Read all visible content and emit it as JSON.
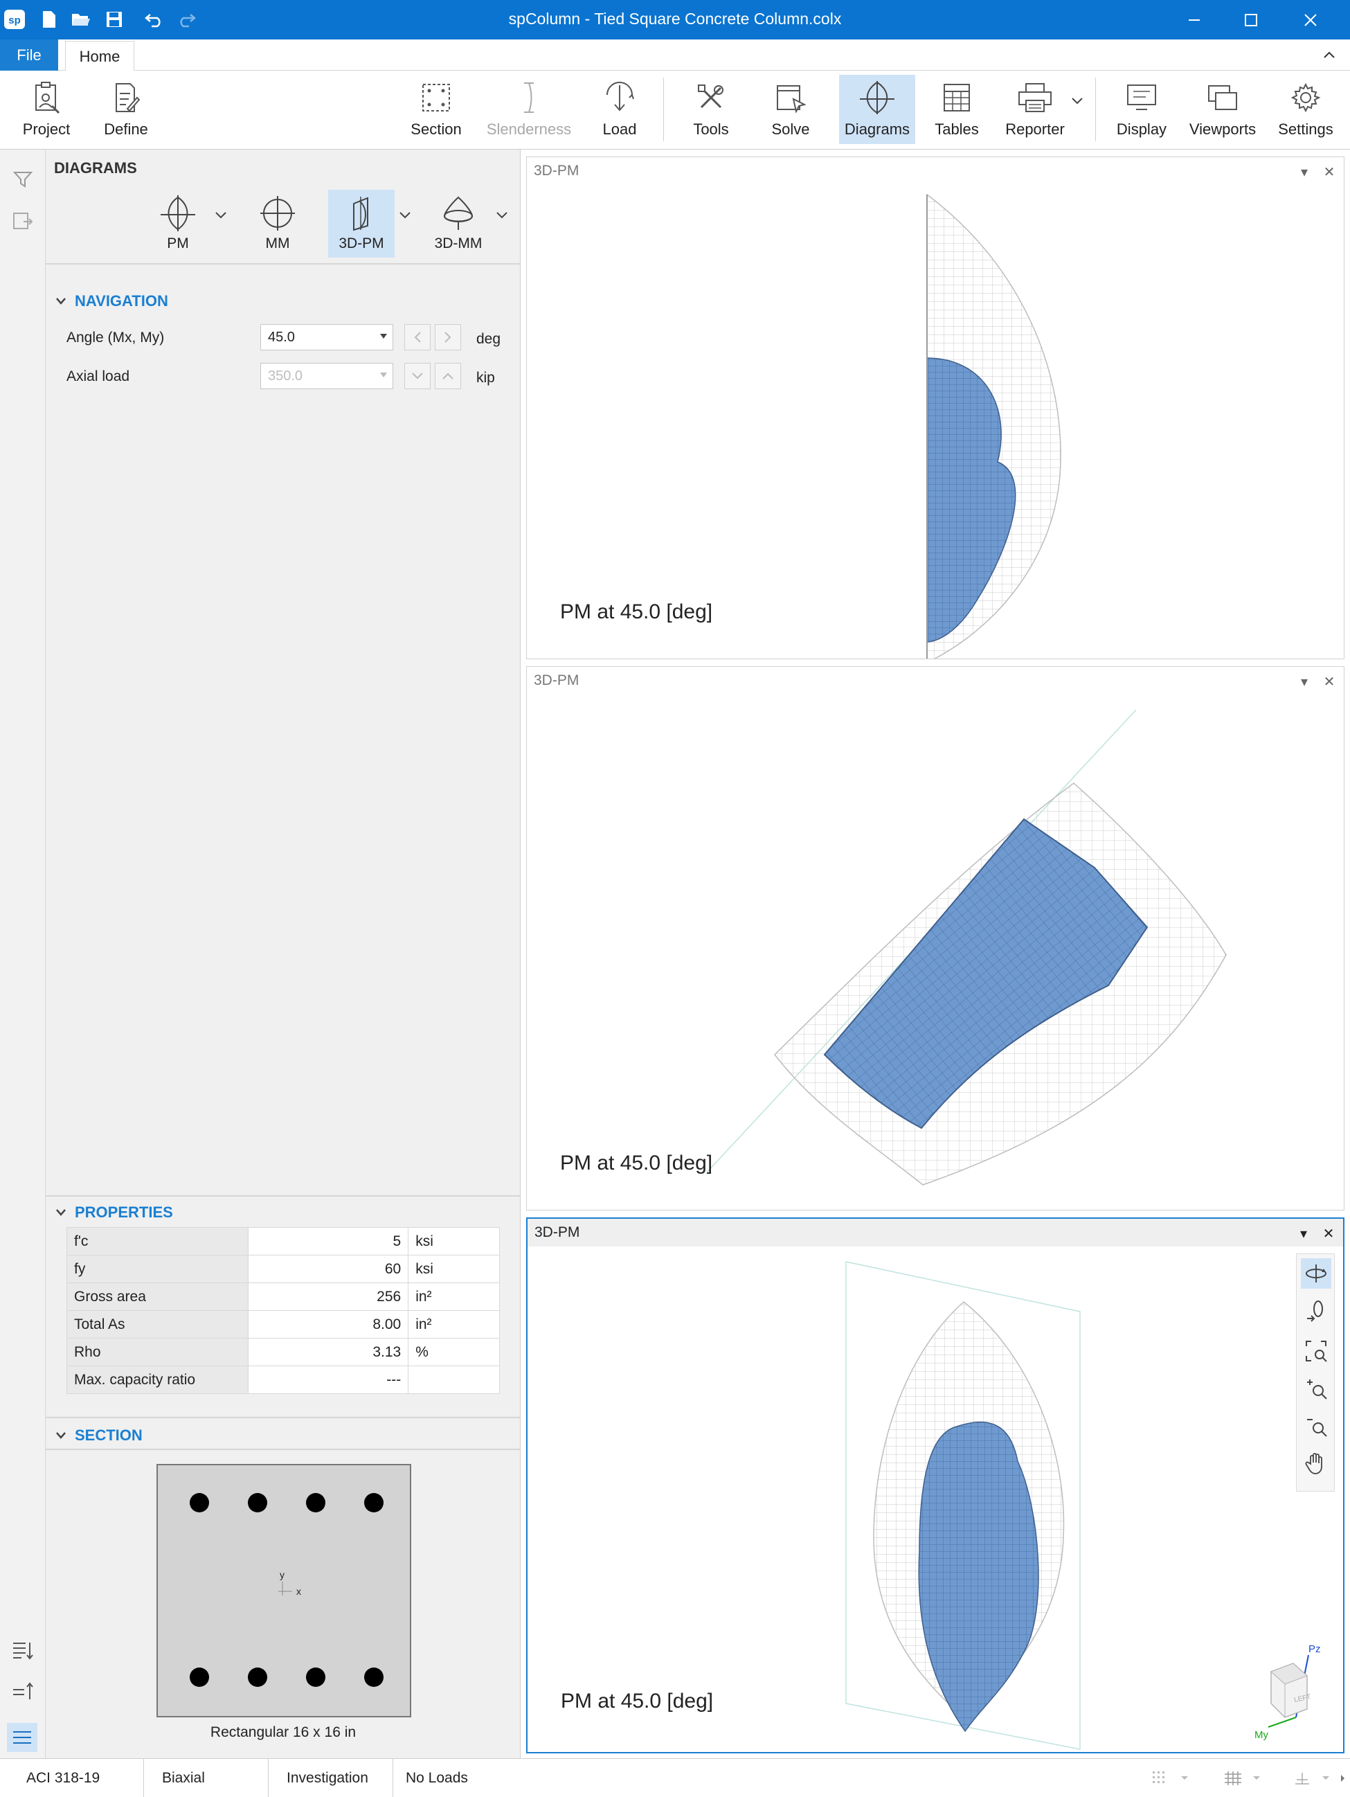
{
  "window": {
    "title": "spColumn - Tied Square Concrete Column.colx"
  },
  "quick_access": [
    "sp-logo-icon",
    "new-icon",
    "open-icon",
    "save-icon",
    "undo-icon",
    "redo-icon"
  ],
  "tabs": {
    "file": "File",
    "home": "Home"
  },
  "ribbon": {
    "project": "Project",
    "define": "Define",
    "section": "Section",
    "slenderness": "Slenderness",
    "load": "Load",
    "tools": "Tools",
    "solve": "Solve",
    "diagrams": "Diagrams",
    "tables": "Tables",
    "reporter": "Reporter",
    "display": "Display",
    "viewports": "Viewports",
    "settings": "Settings"
  },
  "panel": {
    "title": "DIAGRAMS",
    "diagram_buttons": {
      "pm": "PM",
      "mm": "MM",
      "pm3d": "3D-PM",
      "mm3d": "3D-MM"
    },
    "active_diagram": "3D-PM",
    "navigation": {
      "header": "NAVIGATION",
      "angle_label": "Angle (Mx, My)",
      "angle_value": "45.0",
      "angle_unit": "deg",
      "axial_label": "Axial load",
      "axial_value": "350.0",
      "axial_unit": "kip"
    },
    "properties": {
      "header": "PROPERTIES",
      "rows": [
        {
          "key": "f'c",
          "value": "5",
          "unit": "ksi"
        },
        {
          "key": "fy",
          "value": "60",
          "unit": "ksi"
        },
        {
          "key": "Gross area",
          "value": "256",
          "unit": "in²"
        },
        {
          "key": "Total As",
          "value": "8.00",
          "unit": "in²"
        },
        {
          "key": "Rho",
          "value": "3.13",
          "unit": "%"
        },
        {
          "key": "Max. capacity ratio",
          "value": "---",
          "unit": ""
        }
      ]
    },
    "section": {
      "header": "SECTION",
      "caption": "Rectangular 16 x 16 in",
      "axis_y": "y",
      "axis_x": "x"
    }
  },
  "viewports": [
    {
      "title": "3D-PM",
      "caption": "PM at 45.0 [deg]"
    },
    {
      "title": "3D-PM",
      "caption": "PM at 45.0 [deg]"
    },
    {
      "title": "3D-PM",
      "caption": "PM at 45.0 [deg]"
    }
  ],
  "orientation": {
    "cube_face": "LEFT",
    "axis_pz": "Pz",
    "axis_my": "My"
  },
  "status": {
    "code": "ACI 318-19",
    "mode": "Biaxial",
    "run": "Investigation",
    "loads": "No Loads"
  },
  "colors": {
    "accent": "#0a74d0",
    "surface_blue": "#6f9ad0",
    "wire": "#c9c9c9"
  }
}
